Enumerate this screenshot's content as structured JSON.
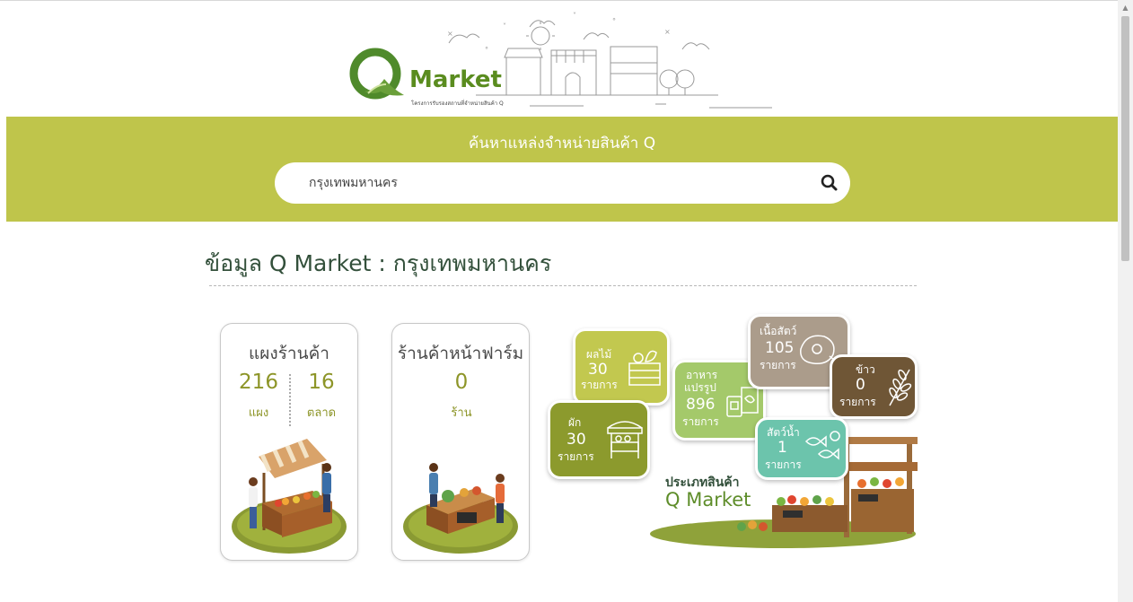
{
  "brand": {
    "name": "Market",
    "tagline": "โครงการรับรองสถานที่จำหน่ายสินค้า Q"
  },
  "search": {
    "title": "ค้นหาแหล่งจำหน่ายสินค้า Q",
    "value": "กรุงเทพมหานคร"
  },
  "section": {
    "title": "ข้อมูล Q Market : กรุงเทพมหานคร"
  },
  "cards": [
    {
      "title": "แผงร้านค้า",
      "stats": [
        {
          "value": "216",
          "unit": "แผง"
        },
        {
          "value": "16",
          "unit": "ตลาด"
        }
      ]
    },
    {
      "title": "ร้านค้าหน้าฟาร์ม",
      "stats": [
        {
          "value": "0",
          "unit": "ร้าน"
        }
      ]
    }
  ],
  "categories": {
    "caption_line1": "ประเภทสินค้า",
    "caption_line2": "Q Market",
    "items": [
      {
        "name": "ผลไม้",
        "count": "30",
        "unit": "รายการ",
        "color": "#c2c84f"
      },
      {
        "name": "ผัก",
        "count": "30",
        "unit": "รายการ",
        "color": "#8c9a2d"
      },
      {
        "name": "อาหาร",
        "name2": "แปรรูป",
        "count": "896",
        "unit": "รายการ",
        "color": "#a4c96a"
      },
      {
        "name": "เนื้อสัตว์",
        "count": "105",
        "unit": "รายการ",
        "color": "#ab9c8b"
      },
      {
        "name": "ข้าว",
        "count": "0",
        "unit": "รายการ",
        "color": "#6f5636"
      },
      {
        "name": "สัตว์น้ำ",
        "count": "1",
        "unit": "รายการ",
        "color": "#6cc4ac"
      }
    ]
  },
  "colors": {
    "band": "#bfc54b",
    "accent_green": "#5a8c1f",
    "stat_olive": "#8d9528"
  }
}
